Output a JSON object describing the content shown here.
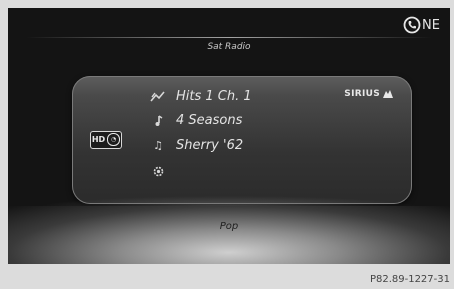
{
  "header": {
    "logo_text": "NE",
    "logo_icon": "phone-circle-icon",
    "title": "Sat Radio"
  },
  "station": {
    "hd_badge_text": "HD",
    "provider": "SIRIUS",
    "provider_icon": "sirius-dog-icon",
    "rows": [
      {
        "icon": "channel-icon",
        "text": "Hits 1 Ch. 1"
      },
      {
        "icon": "artist-icon",
        "text": "4 Seasons"
      },
      {
        "icon": "music-note-icon",
        "text": "Sherry '62"
      },
      {
        "icon": "gear-icon",
        "text": ""
      }
    ]
  },
  "footer": {
    "category": "Pop"
  },
  "figure_code": "P82.89-1227-31"
}
